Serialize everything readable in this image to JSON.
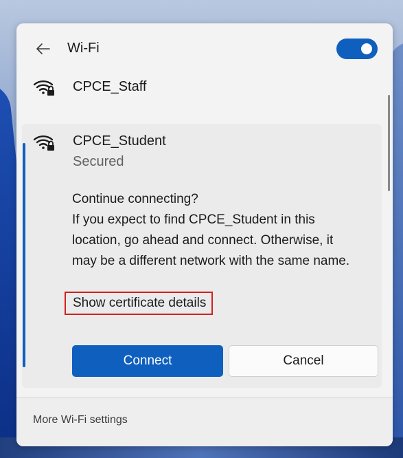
{
  "header": {
    "back_icon": "back-arrow-icon",
    "title": "Wi-Fi",
    "wifi_toggle_on": true,
    "accent_color": "#0f5fbf"
  },
  "networks": [
    {
      "name": "CPCE_Staff",
      "icon": "wifi-secured-icon"
    },
    {
      "name": "CPCE_Student",
      "status": "Secured",
      "icon": "wifi-secured-icon",
      "expanded": true
    }
  ],
  "dialog": {
    "heading": "Continue connecting?",
    "message": "If you expect to find CPCE_Student in this location, go ahead and connect. Otherwise, it may be a different network with the same name.",
    "cert_link": "Show certificate details",
    "connect_label": "Connect",
    "cancel_label": "Cancel",
    "highlight_color": "#d21f1f"
  },
  "footer": {
    "more_settings": "More Wi-Fi settings"
  }
}
